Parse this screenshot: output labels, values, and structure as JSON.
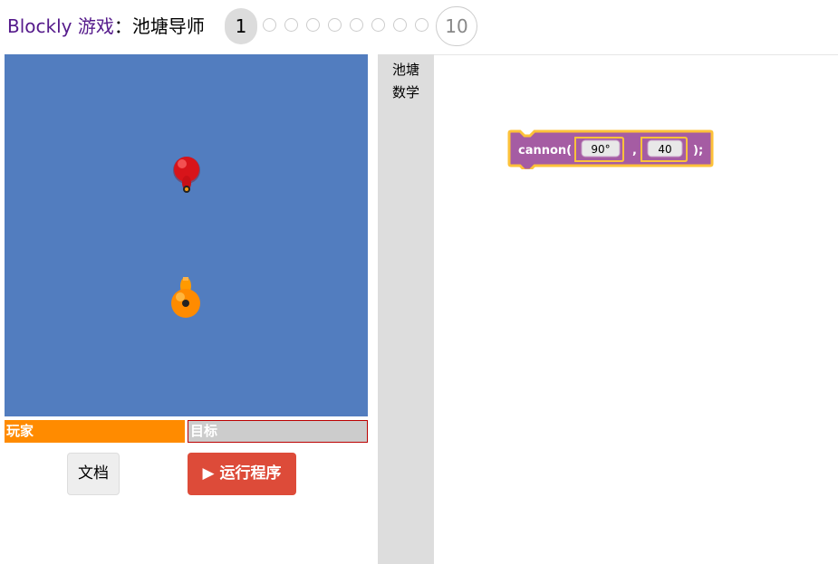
{
  "header": {
    "app_link": "Blockly 游戏",
    "separator": "：",
    "level_name": "池塘导师",
    "current_level": "1",
    "last_level": "10"
  },
  "game": {
    "player_label": "玩家",
    "target_label": "目标",
    "docs_button": "文档",
    "run_button": "运行程序",
    "run_icon": "▶",
    "colors": {
      "pond": "#527dbf",
      "player": "#ff8b00",
      "target": "#cccccc",
      "run": "#dd4b39"
    }
  },
  "toolbox": {
    "categories": [
      "池塘",
      "数学"
    ]
  },
  "workspace": {
    "block": {
      "func": "cannon(",
      "arg1": "90°",
      "comma": ",",
      "arg2": "40",
      "end": ");",
      "color": "#a55ca3",
      "highlight": "#fdc23a"
    }
  }
}
